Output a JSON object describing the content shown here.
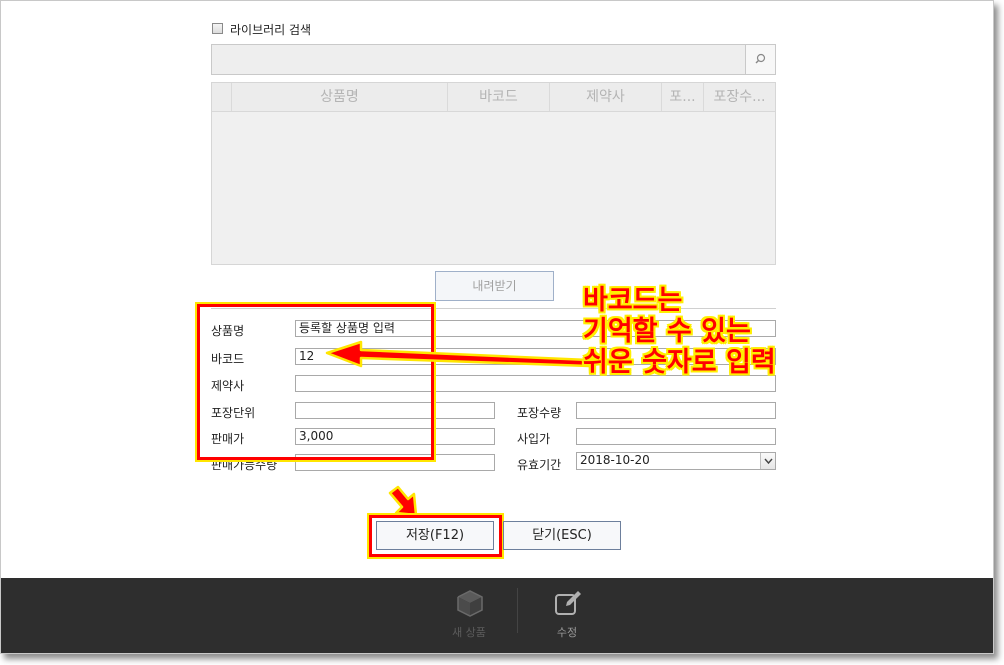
{
  "library": {
    "checkbox_label": "라이브러리 검색",
    "checked": false
  },
  "search": {
    "value": "",
    "icon": "search-icon"
  },
  "grid": {
    "columns": [
      "",
      "상품명",
      "바코드",
      "제약사",
      "포...",
      "포장수..."
    ]
  },
  "download_button": "내려받기",
  "form": {
    "product_name": {
      "label": "상품명",
      "value": "등록할 상품명 입력"
    },
    "barcode": {
      "label": "바코드",
      "value": "12"
    },
    "manufacturer": {
      "label": "제약사",
      "value": ""
    },
    "package_unit": {
      "label": "포장단위",
      "value": ""
    },
    "package_qty": {
      "label": "포장수량",
      "value": ""
    },
    "sale_price": {
      "label": "판매가",
      "value": "3,000"
    },
    "purchase_price": {
      "label": "사입가",
      "value": ""
    },
    "sellable_qty": {
      "label": "판매가능수량",
      "value": ""
    },
    "expiry": {
      "label": "유효기간",
      "value": "2018-10-20"
    }
  },
  "actions": {
    "save": "저장(F12)",
    "close": "닫기(ESC)"
  },
  "annotation": {
    "lines": [
      "바코드는",
      "기억할 수 있는",
      "쉬운 숫자로 입력"
    ],
    "color": "#ff0000",
    "outline": "#ffef00"
  },
  "dock": [
    {
      "icon": "box-icon",
      "label": "새 상품"
    },
    {
      "icon": "edit-icon",
      "label": "수정"
    }
  ]
}
